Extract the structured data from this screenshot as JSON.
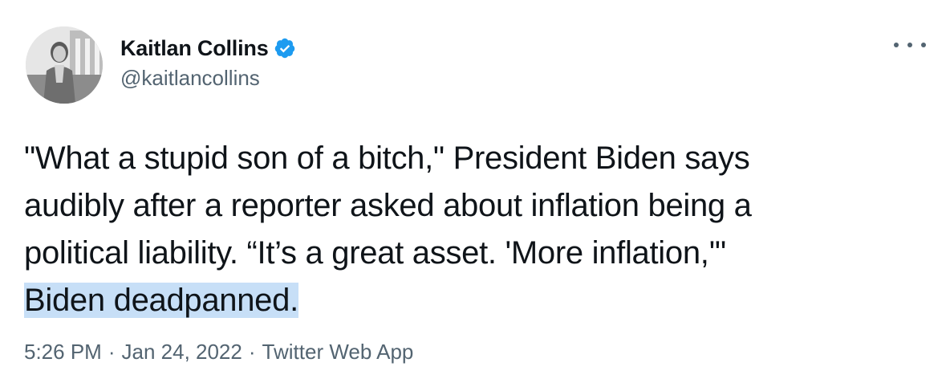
{
  "author": {
    "display_name": "Kaitlan Collins",
    "handle": "@kaitlancollins",
    "verified_icon": "verified-badge-icon",
    "avatar": "profile-photo"
  },
  "menu": {
    "icon": "more-options-icon"
  },
  "tweet": {
    "lines": [
      "\"What a stupid son of a bitch,\" President Biden says",
      "audibly after a reporter asked about inflation being a",
      "political liability. “It’s a great asset. 'More inflation,'\"",
      "Biden deadpanned."
    ]
  },
  "meta": {
    "time": "5:26 PM",
    "separator": "·",
    "date": "Jan 24, 2022",
    "source": "Twitter Web App"
  },
  "colors": {
    "text": "#0f1419",
    "secondary": "#536471",
    "verified": "#1d9bf0",
    "highlight": "#c7dff7"
  }
}
